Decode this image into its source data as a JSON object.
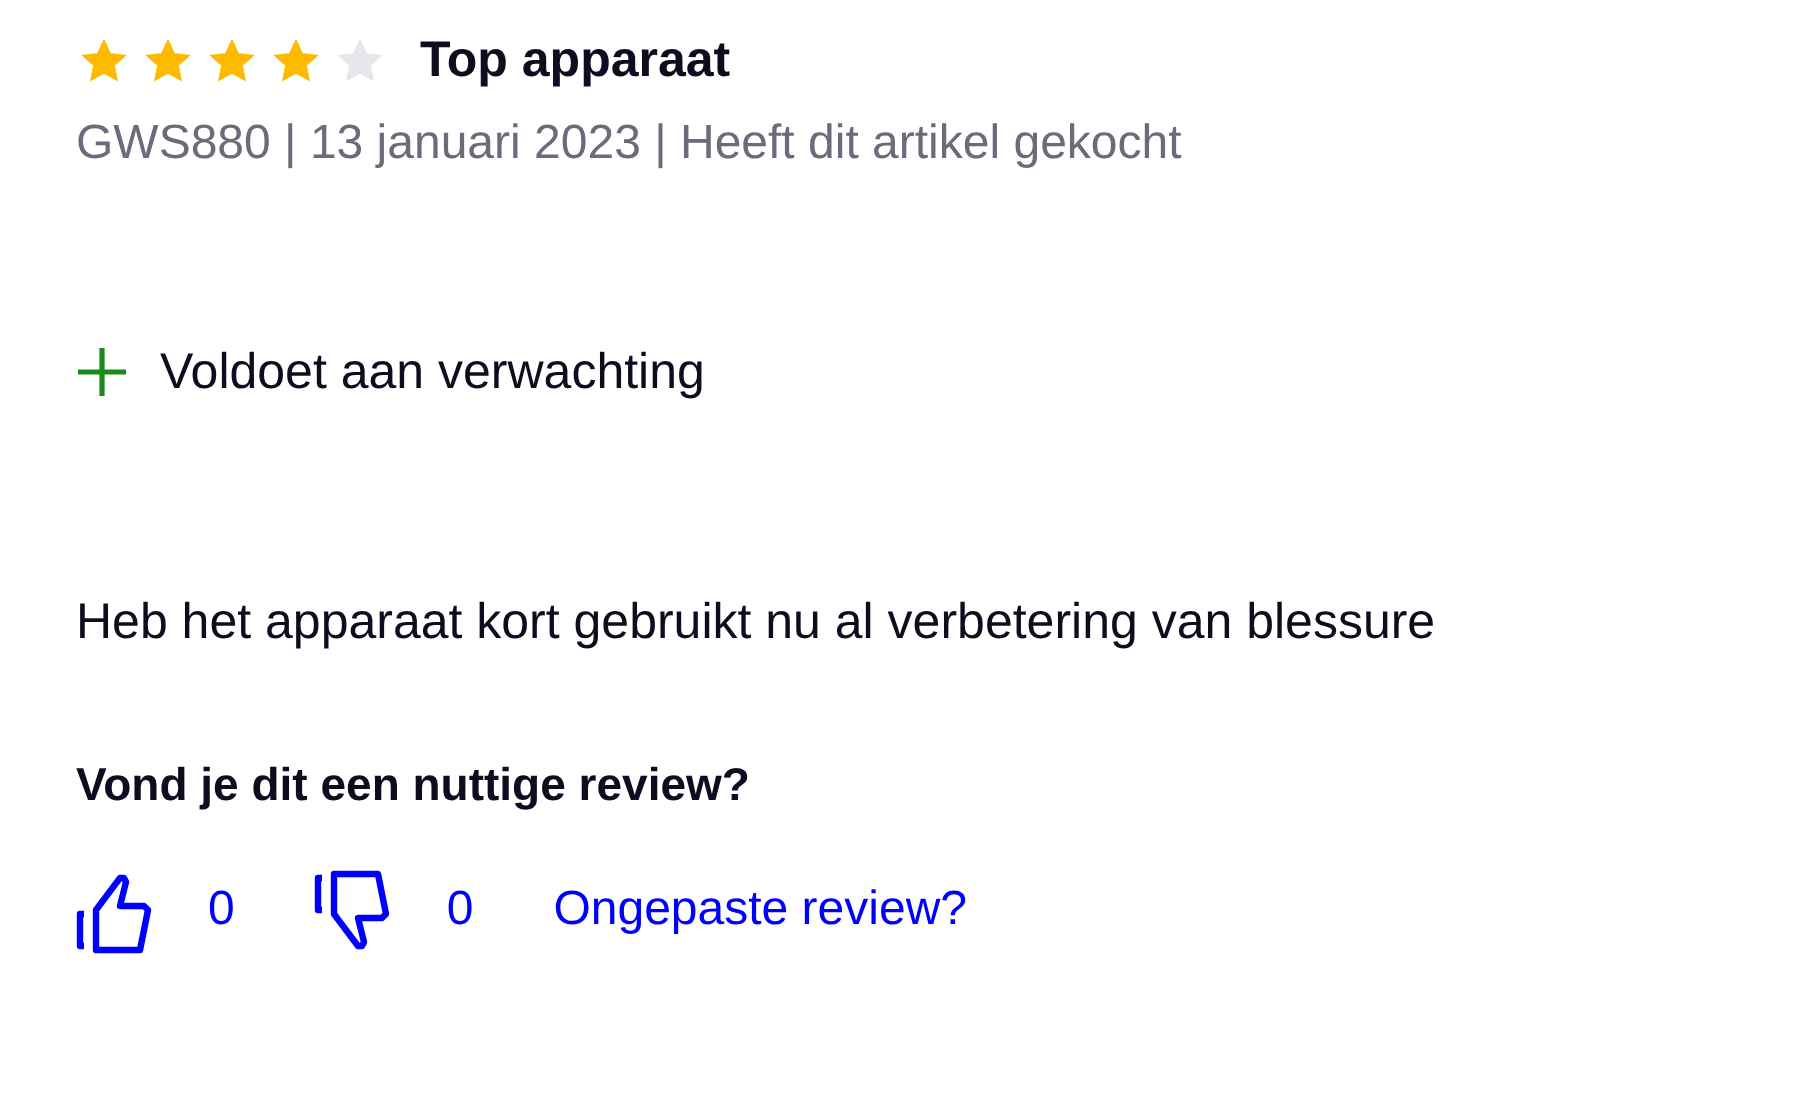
{
  "review": {
    "stars": 4,
    "title": "Top apparaat",
    "meta": "GWS880 | 13 januari 2023 | Heeft dit artikel gekocht",
    "pros": [
      "Voldoet aan verwachting"
    ],
    "body": "Heb het apparaat kort gebruikt nu al verbetering van blessure",
    "helpful_question": "Vond je dit een nuttige review?",
    "likes": "0",
    "dislikes": "0",
    "report_link": "Ongepaste review?"
  }
}
